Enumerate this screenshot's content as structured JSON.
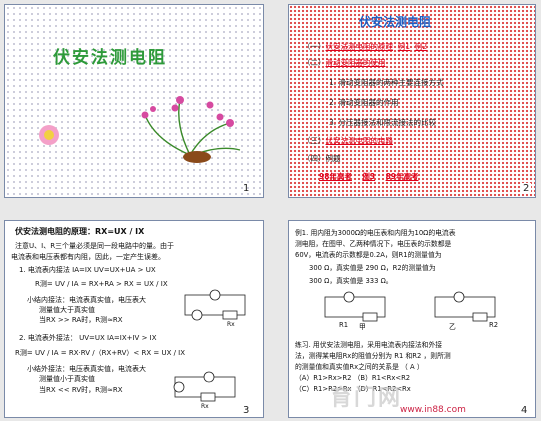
{
  "slide1": {
    "number": "1",
    "title": "伏安法测电阻"
  },
  "slide2": {
    "number": "2",
    "title": "伏安法测电阻",
    "items": [
      {
        "prefix": "（一）",
        "text": "伏安法测电阻的原理",
        "links": [
          "例1",
          "例2"
        ]
      },
      {
        "prefix": "（二）",
        "text": "滑动变阻器的使用"
      },
      {
        "prefix": "1.",
        "text": "滑动变阻器的两种主要连接方式"
      },
      {
        "prefix": "2.",
        "text": "滑动变阻器的作用"
      },
      {
        "prefix": "3.",
        "text": "分压器接法和限流接法的比较"
      },
      {
        "prefix": "（三）",
        "text": "伏安法测电阻的电路"
      },
      {
        "prefix": "（四）",
        "text": "例题"
      },
      {
        "links": [
          "98年高考",
          "例3",
          "89年高考"
        ]
      }
    ]
  },
  "slide3": {
    "number": "3",
    "heading": "伏安法测电阻的原理：RX=UX / IX",
    "lines": [
      "注意U、I、R三个量必须是同一段电路中的量。由于",
      "电流表和电压表都有内阻，因此，一定产生误差。",
      "1. 电流表内接法      IA=IX   UV=UX+UA > UX",
      "R测= UV / IA = RX+RA > RX = UX / IX",
      "小结内接法：电流表真实值，电压表大",
      "测量值大于真实值",
      "当RX >> RA时，R测≈RX",
      "2. 电流表外接法：    UV=UX     IA=IX+IV > IX",
      "R测= UV / IA = RX·RV /（RX+RV）< RX = UX / IX",
      "小结外接法：电压表真实值，电流表大",
      "测量值小于真实值",
      "当RX << RV时，R测≈RX"
    ],
    "labels": {
      "r1": "Rx",
      "r2": "Rx",
      "a": "A",
      "v": "V"
    }
  },
  "slide4": {
    "number": "4",
    "lines": [
      "例1. 用内阻为3000Ω的电压表和内阻为10Ω的电流表",
      "测电阻，在图甲、乙两种情况下，电压表的示数都是",
      "60V，电流表的示数都是0.2A，则R1的测量值为",
      "300  Ω，真实值是  290  Ω，R2的测量值为",
      "300  Ω，真实值是  333  Ω。",
      "练习. 用伏安法测电阻，采用电流表内接法和外接",
      "法，测得某电阻Rx的阻值分别为 R1 和R2 ，则所测",
      "的测量值和真实值Rx之间的关系是      （ A ）",
      "（A）R1>Rx>R2   （B）R1<Rx<R2",
      "（C）R1>R2>Rx   （D）R1<R2<Rx"
    ],
    "labels": {
      "jia": "甲",
      "yi": "乙",
      "r1": "R1",
      "r2": "R2"
    }
  },
  "watermark": {
    "main": "育门网",
    "url": "www.in88.com"
  },
  "colors": {
    "title_green": "#2e9a3a",
    "red": "#e0001a",
    "blue": "#1d5fc4"
  }
}
